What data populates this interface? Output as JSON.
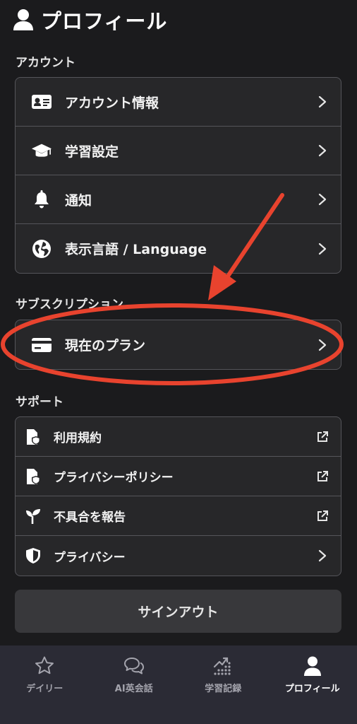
{
  "header": {
    "title": "プロフィール",
    "icon": "person-icon"
  },
  "sections": {
    "account": {
      "label": "アカウント",
      "items": [
        {
          "label": "アカウント情報",
          "icon": "id-card-icon"
        },
        {
          "label": "学習設定",
          "icon": "graduation-cap-icon"
        },
        {
          "label": "通知",
          "icon": "bell-icon"
        },
        {
          "label": "表示言語 / Language",
          "icon": "globe-icon"
        }
      ]
    },
    "subscription": {
      "label": "サブスクリプション",
      "items": [
        {
          "label": "現在のプラン",
          "icon": "credit-card-icon"
        }
      ]
    },
    "support": {
      "label": "サポート",
      "items": [
        {
          "label": "利用規約",
          "icon": "document-shield-icon"
        },
        {
          "label": "プライバシーポリシー",
          "icon": "document-shield-icon"
        },
        {
          "label": "不具合を報告",
          "icon": "sprout-icon"
        },
        {
          "label": "プライバシー",
          "icon": "shield-icon"
        }
      ]
    }
  },
  "signout": {
    "label": "サインアウト"
  },
  "tabbar": {
    "tabs": [
      {
        "label": "デイリー",
        "icon": "star-icon"
      },
      {
        "label": "AI英会話",
        "icon": "chat-bubbles-icon"
      },
      {
        "label": "学習記録",
        "icon": "chart-icon"
      },
      {
        "label": "プロフィール",
        "icon": "person-icon",
        "active": true
      }
    ]
  },
  "colors": {
    "background": "#1b1b1d",
    "card": "#272729",
    "border": "#55555a",
    "tabbar": "#2b2b35",
    "annotation": "#e8432e"
  }
}
